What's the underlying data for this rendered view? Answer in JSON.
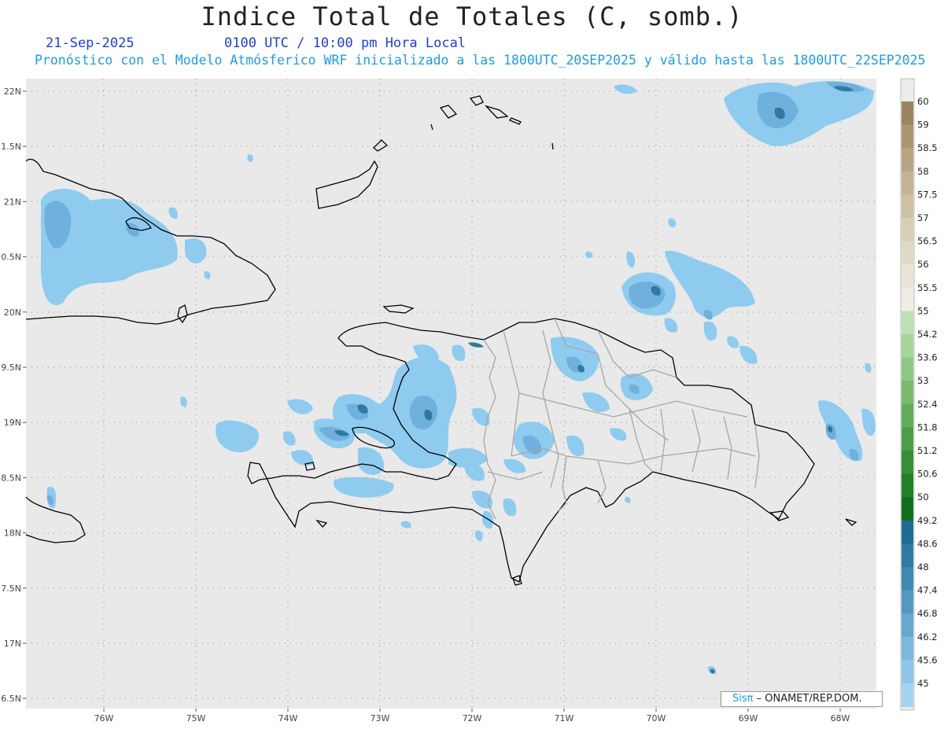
{
  "header": {
    "title": "Indice Total de Totales (C, somb.)",
    "date": "21-Sep-2025",
    "time": "0100 UTC / 10:00 pm Hora Local",
    "description": "Pronóstico con el Modelo Atmósferico WRF inicializado a las 1800UTC_20SEP2025 y válido hasta las  1800UTC_22SEP2025"
  },
  "axes": {
    "lat_labels": [
      "22N",
      "1.5N",
      "21N",
      "0.5N",
      "20N",
      "9.5N",
      "19N",
      "8.5N",
      "18N",
      "7.5N",
      "17N",
      "6.5N"
    ],
    "lon_labels": [
      "76W",
      "75W",
      "74W",
      "73W",
      "72W",
      "71W",
      "70W",
      "69W",
      "68W"
    ]
  },
  "colorbar": {
    "labels": [
      "60",
      "59",
      "58.5",
      "58",
      "57.5",
      "57",
      "56.5",
      "56",
      "55.5",
      "55",
      "54.2",
      "53.6",
      "53",
      "52.4",
      "51.8",
      "51.2",
      "50.6",
      "50",
      "49.2",
      "48.6",
      "48",
      "47.4",
      "46.8",
      "46.2",
      "45.6",
      "45"
    ],
    "colors": [
      "#9b8560",
      "#ab9670",
      "#b8a582",
      "#c4b495",
      "#cec1a6",
      "#d8cdb7",
      "#e1d9c8",
      "#e9e4d8",
      "#f0ede5",
      "#bde0b5",
      "#a6d59b",
      "#8ec883",
      "#78bb6d",
      "#62ad59",
      "#4c9e46",
      "#378f35",
      "#237f26",
      "#0f6f1a",
      "#1f6a90",
      "#2f7aa0",
      "#3f89b0",
      "#5298bf",
      "#66a8cf",
      "#7ab8de",
      "#8ec7ea",
      "#a3d5f3"
    ]
  },
  "credit": {
    "brand": "Sisπ",
    "text": "– ONAMET/REP.DOM."
  },
  "colors": {
    "map_background": "#e9e9e9",
    "coastline": "#000000",
    "province_border": "#a6a6a6",
    "shade_light": "#8fcbef",
    "shade_mid": "#6fb0dc",
    "shade_dark": "#2f7aa0"
  }
}
